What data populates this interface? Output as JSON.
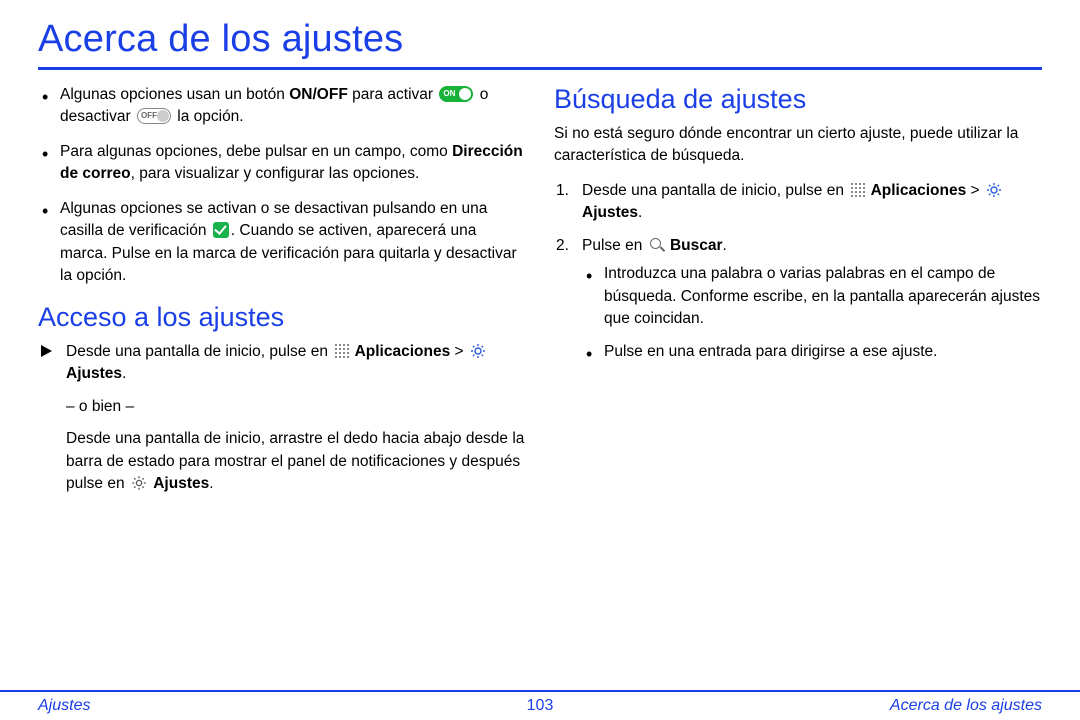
{
  "title": "Acerca de los ajustes",
  "left": {
    "bullets": [
      {
        "pre": "Algunas opciones usan un botón ",
        "b1": "ON/OFF",
        "mid1": " para activar ",
        "icon1": "toggle-on",
        "mid2": " o desactivar ",
        "icon2": "toggle-off",
        "post": " la opción."
      },
      {
        "pre": "Para algunas opciones, debe pulsar en un campo, como ",
        "b1": "Dirección de correo",
        "post": ", para visualizar y configurar las opciones."
      },
      {
        "pre": "Algunas opciones se activan o se desactivan pulsando en una casilla de verificación ",
        "icon1": "checkbox-checked",
        "post": ". Cuando se activen, aparecerá una marca. Pulse en la marca de verificación para quitarla y desactivar la opción."
      }
    ],
    "h2": "Acceso a los ajustes",
    "step": {
      "line1_pre": "Desde una pantalla de inicio, pulse en ",
      "apps": "Aplicaciones",
      "gt": " > ",
      "settings": "Ajustes",
      "or": "– o bien –",
      "line2_pre": "Desde una pantalla de inicio, arrastre el dedo hacia abajo desde la barra de estado para mostrar el panel de notificaciones y después pulse en ",
      "settings2": "Ajustes"
    }
  },
  "right": {
    "h2": "Búsqueda de ajustes",
    "intro": "Si no está seguro dónde encontrar un cierto ajuste, puede utilizar la característica de búsqueda.",
    "step1_pre": "Desde una pantalla de inicio, pulse en ",
    "apps": "Aplicaciones",
    "gt": " > ",
    "settings": "Ajustes",
    "step2_pre": "Pulse en ",
    "search": "Buscar",
    "sub1": "Introduzca una palabra o varias palabras en el campo de búsqueda. Conforme escribe, en la pantalla aparecerán ajustes que coincidan.",
    "sub2": "Pulse en una entrada para dirigirse a ese ajuste."
  },
  "footer": {
    "left": "Ajustes",
    "center": "103",
    "right": "Acerca de los ajustes"
  }
}
